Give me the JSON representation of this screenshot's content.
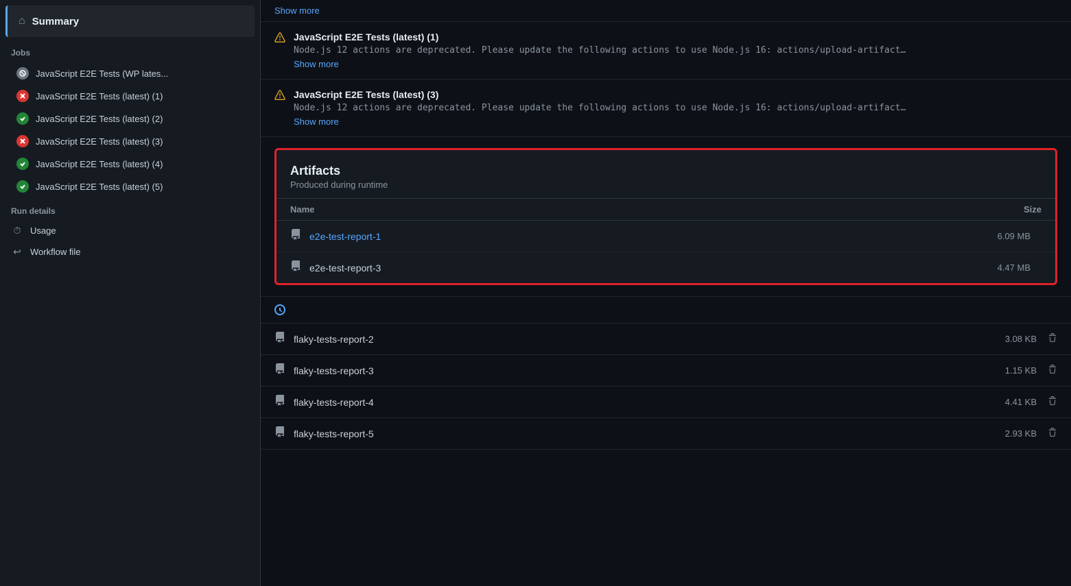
{
  "sidebar": {
    "summary_label": "Summary",
    "jobs_section_label": "Jobs",
    "jobs": [
      {
        "id": "job-wp",
        "label": "JavaScript E2E Tests (WP lates...",
        "status": "cancelled"
      },
      {
        "id": "job-1",
        "label": "JavaScript E2E Tests (latest) (1)",
        "status": "failed"
      },
      {
        "id": "job-2",
        "label": "JavaScript E2E Tests (latest) (2)",
        "status": "success"
      },
      {
        "id": "job-3",
        "label": "JavaScript E2E Tests (latest) (3)",
        "status": "failed"
      },
      {
        "id": "job-4",
        "label": "JavaScript E2E Tests (latest) (4)",
        "status": "success"
      },
      {
        "id": "job-5",
        "label": "JavaScript E2E Tests (latest) (5)",
        "status": "success"
      }
    ],
    "run_details_label": "Run details",
    "run_details": [
      {
        "id": "usage",
        "label": "Usage",
        "icon": "⏱"
      },
      {
        "id": "workflow-file",
        "label": "Workflow file",
        "icon": "↩"
      }
    ]
  },
  "main": {
    "top_show_more": "Show more",
    "annotations": [
      {
        "id": "ann-1",
        "title": "JavaScript E2E Tests (latest) (1)",
        "body": "Node.js 12 actions are deprecated. Please update the following actions to use Node.js 16: actions/upload-artifact...",
        "show_more": "Show more"
      },
      {
        "id": "ann-3",
        "title": "JavaScript E2E Tests (latest) (3)",
        "body": "Node.js 12 actions are deprecated. Please update the following actions to use Node.js 16: actions/upload-artifact...",
        "show_more": "Show more"
      }
    ],
    "artifacts_section": {
      "title": "Artifacts",
      "subtitle": "Produced during runtime",
      "col_name": "Name",
      "col_size": "Size",
      "highlighted_items": [
        {
          "id": "e2e-report-1",
          "name": "e2e-test-report-1",
          "size": "6.09 MB",
          "link": true
        },
        {
          "id": "e2e-report-3",
          "name": "e2e-test-report-3",
          "size": "4.47 MB",
          "link": false
        }
      ],
      "partial_row_visible": true,
      "other_items": [
        {
          "id": "flaky-2",
          "name": "flaky-tests-report-2",
          "size": "3.08 KB"
        },
        {
          "id": "flaky-3",
          "name": "flaky-tests-report-3",
          "size": "1.15 KB"
        },
        {
          "id": "flaky-4",
          "name": "flaky-tests-report-4",
          "size": "4.41 KB"
        },
        {
          "id": "flaky-5",
          "name": "flaky-tests-report-5",
          "size": "2.93 KB"
        }
      ]
    }
  }
}
